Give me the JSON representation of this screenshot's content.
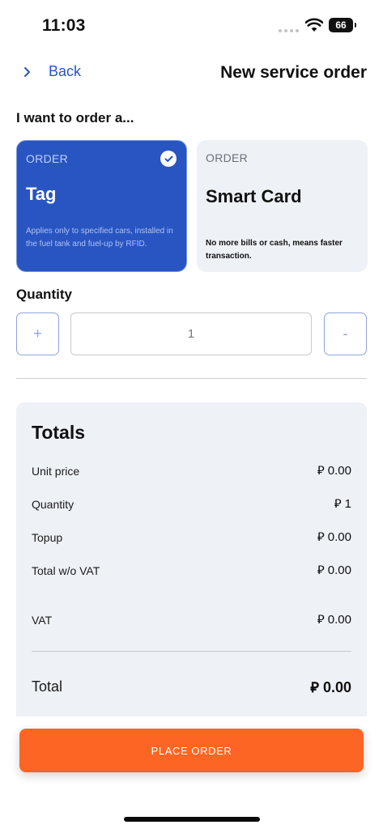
{
  "status_bar": {
    "time": "11:03",
    "battery": "66"
  },
  "nav": {
    "back_label": "Back",
    "title": "New service order"
  },
  "order_section": {
    "heading": "I want to order a...",
    "options": [
      {
        "kicker": "ORDER",
        "name": "Tag",
        "description": "Applies only to specified cars, installed in the fuel tank and fuel-up by RFID.",
        "selected": true
      },
      {
        "kicker": "ORDER",
        "name": "Smart Card",
        "description": "No more bills or cash, means faster transaction.",
        "selected": false
      }
    ]
  },
  "quantity": {
    "heading": "Quantity",
    "plus_label": "+",
    "minus_label": "-",
    "value": "1"
  },
  "totals": {
    "title": "Totals",
    "rows": [
      {
        "label": "Unit price",
        "value": "⃁ 0.00"
      },
      {
        "label": "Quantity",
        "value": "⃁ 1"
      },
      {
        "label": "Topup",
        "value": "⃁ 0.00"
      },
      {
        "label": "Total w/o VAT",
        "value": "⃁ 0.00"
      },
      {
        "label": "VAT",
        "value": "⃁ 0.00"
      }
    ],
    "total": {
      "label": "Total",
      "value": "⃁ 0.00"
    }
  },
  "actions": {
    "place_order_label": "PLACE ORDER"
  },
  "colors": {
    "accent": "#2855c2",
    "cta": "#fd6524",
    "panel": "#eef1f6"
  }
}
